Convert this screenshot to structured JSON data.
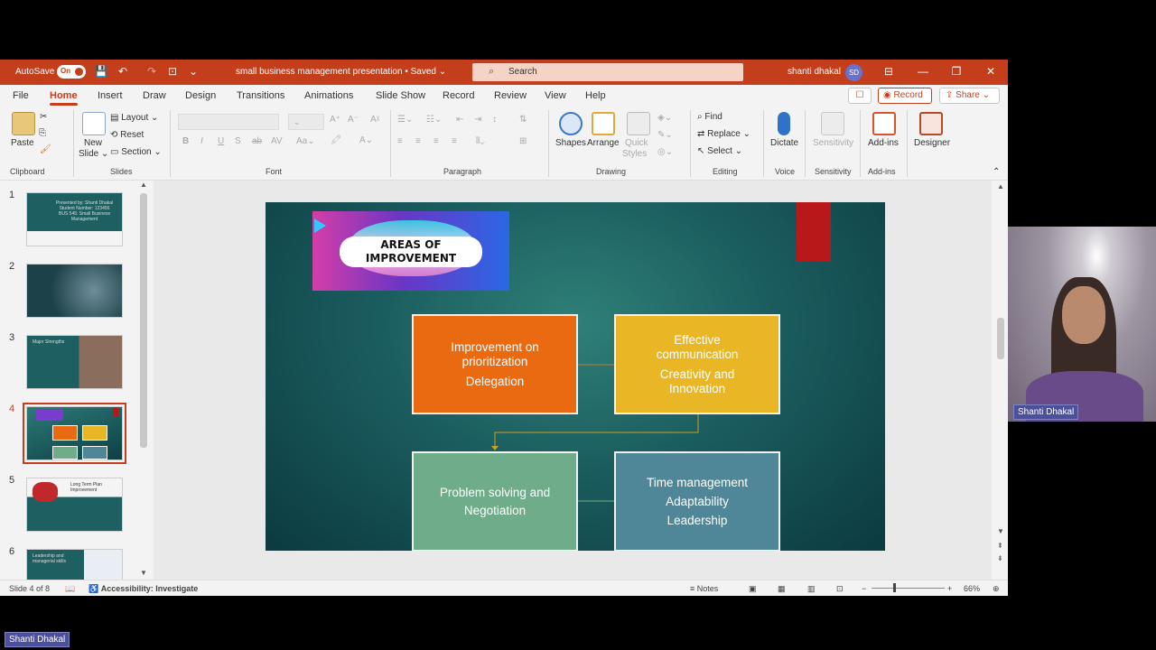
{
  "titlebar": {
    "autosave_label": "AutoSave",
    "autosave_state": "On",
    "doc_title": "small business management presentation • Saved ⌄",
    "search_placeholder": "Search",
    "user_name": "shanti dhakal",
    "user_initials": "SD"
  },
  "menu": {
    "tabs": [
      "File",
      "Home",
      "Insert",
      "Draw",
      "Design",
      "Transitions",
      "Animations",
      "Slide Show",
      "Record",
      "Review",
      "View",
      "Help"
    ],
    "active_tab": "Home",
    "record_label": "Record",
    "share_label": "Share"
  },
  "ribbon": {
    "clipboard": {
      "paste": "Paste",
      "label": "Clipboard"
    },
    "slides": {
      "new_slide": "New",
      "new_slide2": "Slide ⌄",
      "layout": "Layout ⌄",
      "reset": "Reset",
      "section": "Section ⌄",
      "label": "Slides"
    },
    "font": {
      "label": "Font"
    },
    "paragraph": {
      "label": "Paragraph"
    },
    "drawing": {
      "shapes": "Shapes",
      "arrange": "Arrange",
      "quick_styles": "Quick",
      "quick_styles2": "Styles",
      "label": "Drawing"
    },
    "editing": {
      "find": "Find",
      "replace": "Replace",
      "select": "Select ⌄",
      "label": "Editing"
    },
    "voice": {
      "dictate": "Dictate",
      "label": "Voice"
    },
    "sensitivity": {
      "button": "Sensitivity",
      "label": "Sensitivity"
    },
    "addins": {
      "button": "Add-ins",
      "label": "Add-ins"
    },
    "designer": {
      "button": "Designer"
    }
  },
  "thumbnails": [
    {
      "num": "1",
      "text": "Presented by: Shanti Dhakal\nStudent Number: 123456\nBUS 545: Small Business Management"
    },
    {
      "num": "2",
      "text": ""
    },
    {
      "num": "3",
      "text": "Major Strengths"
    },
    {
      "num": "4",
      "text": "",
      "active": true
    },
    {
      "num": "5",
      "text": "Long Term Plan\nImprovement"
    },
    {
      "num": "6",
      "text": "Leadership and\nmanagerial skills"
    }
  ],
  "slide": {
    "banner_title_1": "AREAS OF",
    "banner_title_2": "IMPROVEMENT",
    "box1": {
      "line1": "Improvement on",
      "line2": "prioritization",
      "line3": "Delegation",
      "color": "#ea6a12"
    },
    "box2": {
      "line1": "Effective",
      "line2": "communication",
      "line3": "Creativity and",
      "line4": "Innovation",
      "color": "#e9b626"
    },
    "box3": {
      "line1": "Problem solving and",
      "line2": "Negotiation",
      "color": "#6fad8a"
    },
    "box4": {
      "line1": "Time management",
      "line2": "Adaptability",
      "line3": "Leadership",
      "color": "#4f8798"
    }
  },
  "status": {
    "slide_info": "Slide 4 of 8",
    "accessibility": "Accessibility: Investigate",
    "notes": "Notes",
    "zoom": "66%"
  },
  "webcam": {
    "name": "Shanti Dhakal"
  },
  "bottom_name": "Shanti Dhakal"
}
